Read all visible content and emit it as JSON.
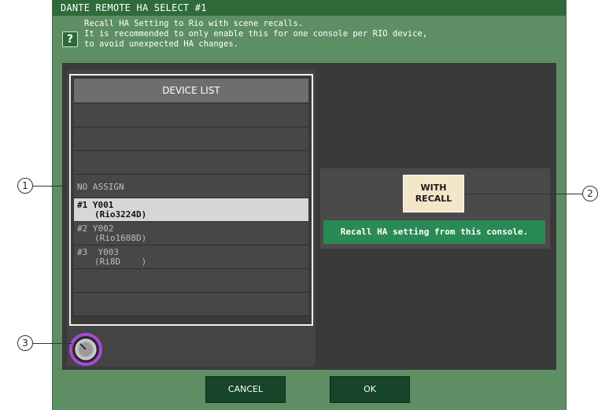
{
  "dialog": {
    "title": "DANTE REMOTE HA SELECT #1",
    "help_lines": [
      "Recall HA Setting to Rio with scene recalls.",
      "It is recommended to only enable this for one console per RIO device,",
      "to avoid unexpected HA changes."
    ]
  },
  "device_list": {
    "header": "DEVICE LIST",
    "rows": [
      {
        "line1": "",
        "line2": ""
      },
      {
        "line1": "",
        "line2": ""
      },
      {
        "line1": "",
        "line2": ""
      },
      {
        "line1": "NO ASSIGN",
        "line2": ""
      },
      {
        "line1": "#1  Y001",
        "line2": "(Rio3224D)",
        "selected": true
      },
      {
        "line1": "#2  Y002",
        "line2": "(Rio1608D)"
      },
      {
        "line1": "#3  Y003",
        "line2": "(Ri8D    )"
      },
      {
        "line1": "",
        "line2": ""
      },
      {
        "line1": "",
        "line2": ""
      }
    ]
  },
  "recall": {
    "button_line1": "WITH",
    "button_line2": "RECALL",
    "status": "Recall HA setting from this console."
  },
  "buttons": {
    "cancel": "CANCEL",
    "ok": "OK"
  },
  "callouts": {
    "c1": "1",
    "c2": "2",
    "c3": "3"
  },
  "colors": {
    "dialog_bg": "#5e8f64",
    "title_bg": "#2f6b3a",
    "status_bg": "#2a8a55",
    "recall_bg": "#f2e7c9",
    "knob_ring": "#a64bd6"
  }
}
